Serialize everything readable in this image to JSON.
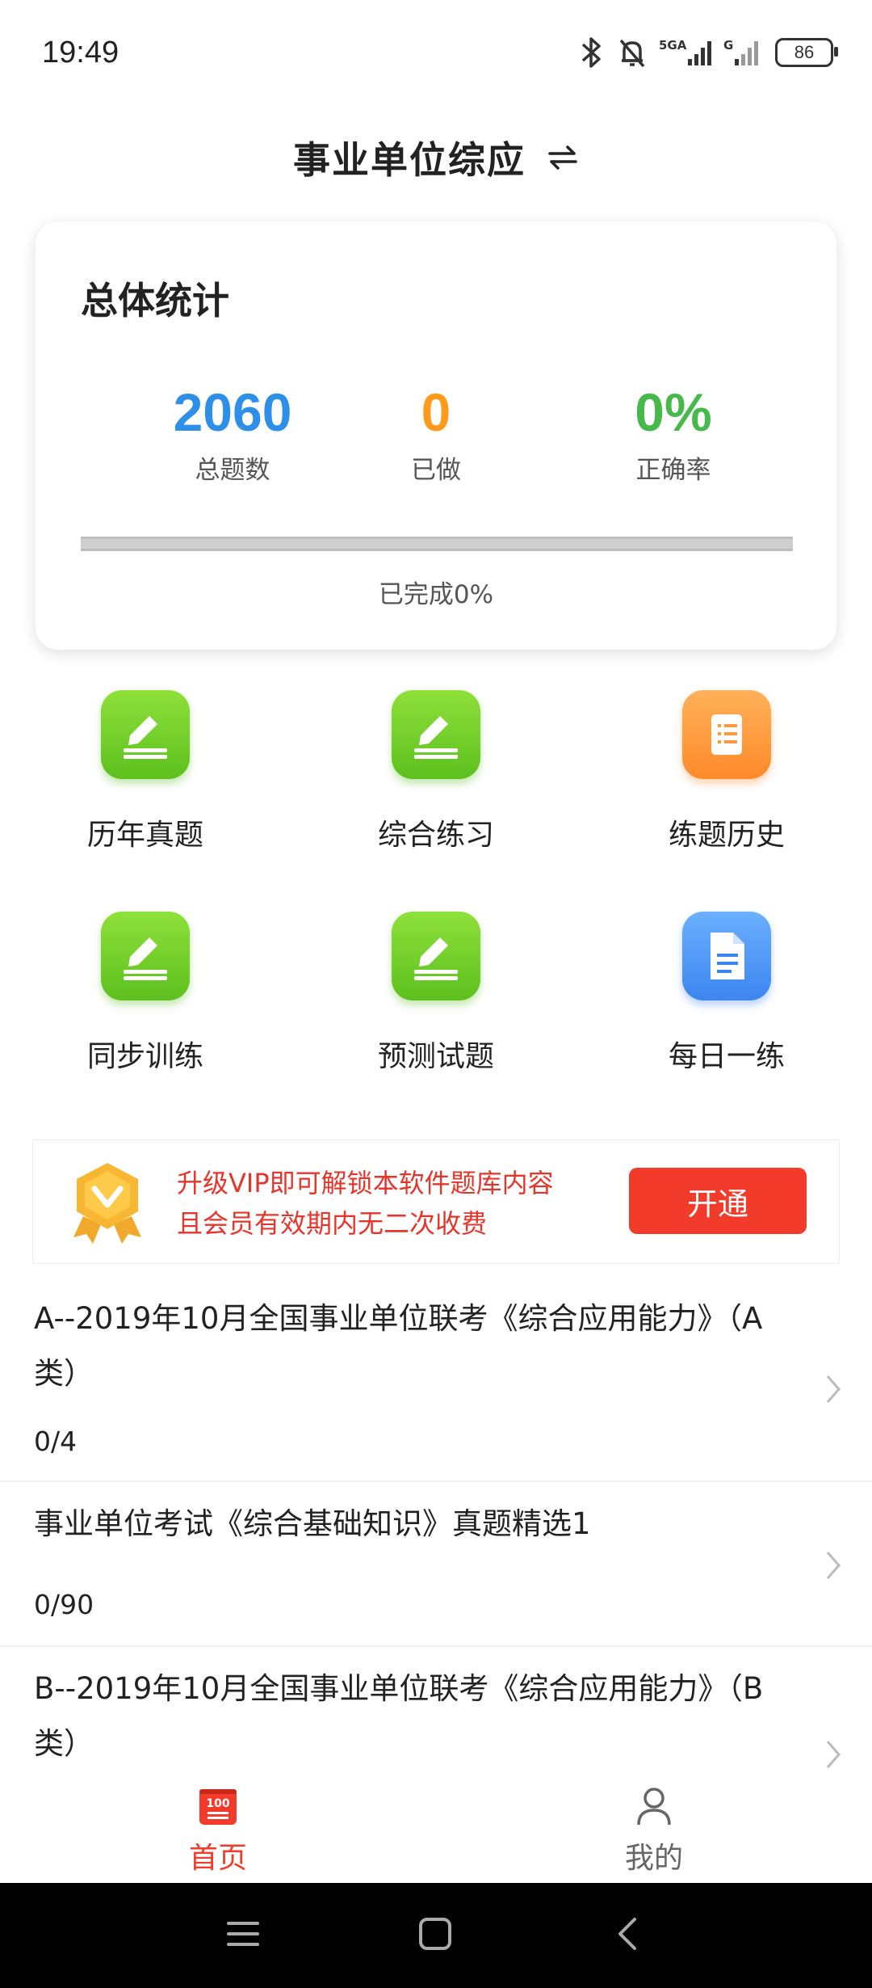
{
  "status": {
    "time": "19:49",
    "battery": "86"
  },
  "header": {
    "title": "事业单位综应"
  },
  "stats": {
    "title": "总体统计",
    "total": {
      "value": "2060",
      "label": "总题数",
      "color": "#2e8fe8"
    },
    "done": {
      "value": "0",
      "label": "已做",
      "color": "#ff9a1a"
    },
    "accuracy": {
      "value": "0%",
      "label": "正确率",
      "color": "#47b84a"
    },
    "progress_fraction": 0,
    "progress_text": "已完成0%"
  },
  "grid": [
    {
      "label": "历年真题",
      "icon": "pencil-icon",
      "color": "green"
    },
    {
      "label": "综合练习",
      "icon": "pencil-icon",
      "color": "green"
    },
    {
      "label": "练题历史",
      "icon": "scroll-icon",
      "color": "orange"
    },
    {
      "label": "同步训练",
      "icon": "pencil-icon",
      "color": "green"
    },
    {
      "label": "预测试题",
      "icon": "pencil-icon",
      "color": "green"
    },
    {
      "label": "每日一练",
      "icon": "document-icon",
      "color": "blue"
    }
  ],
  "vip": {
    "line1": "升级VIP即可解锁本软件题库内容",
    "line2": "且会员有效期内无二次收费",
    "button": "开通"
  },
  "list": [
    {
      "title": "A--2019年10月全国事业单位联考《综合应用能力》（A类）",
      "progress": "0/4"
    },
    {
      "title": "事业单位考试《综合基础知识》真题精选1",
      "progress": "0/90"
    },
    {
      "title": "B--2019年10月全国事业单位联考《综合应用能力》（B类）",
      "progress": ""
    }
  ],
  "tabs": {
    "home": {
      "label": "首页",
      "icon_text": "100"
    },
    "mine": {
      "label": "我的"
    }
  },
  "colors": {
    "accent": "#f23b2a",
    "tab_inactive": "#666666"
  }
}
